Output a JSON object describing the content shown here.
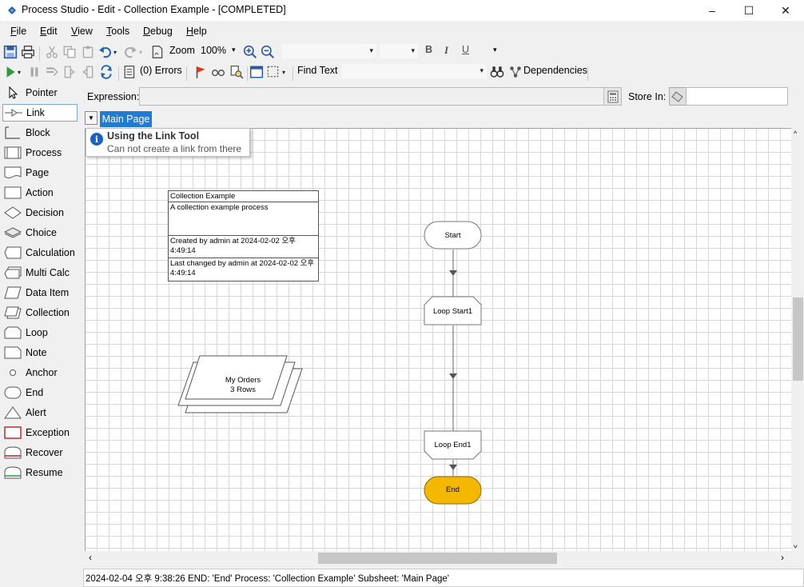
{
  "window": {
    "title": "Process Studio  - Edit - Collection Example - [COMPLETED]",
    "minimize": "–",
    "maximize": "☐",
    "close": "✕"
  },
  "menu": [
    {
      "label": "File",
      "key": "F",
      "rest": "ile"
    },
    {
      "label": "Edit",
      "key": "E",
      "rest": "dit"
    },
    {
      "label": "View",
      "key": "V",
      "rest": "iew"
    },
    {
      "label": "Tools",
      "key": "T",
      "rest": "ools"
    },
    {
      "label": "Debug",
      "key": "D",
      "rest": "ebug"
    },
    {
      "label": "Help",
      "key": "H",
      "rest": "elp"
    }
  ],
  "toolbar1": {
    "zoom_label": "Zoom",
    "zoom_value": "100%",
    "bold": "B",
    "italic": "I",
    "underline": "U"
  },
  "toolbar2": {
    "errors_label": "(0) Errors",
    "find_text": "Find Text",
    "dependencies": "Dependencies"
  },
  "toolbox": [
    {
      "name": "pointer",
      "label": "Pointer",
      "icon": "pointer-icon"
    },
    {
      "name": "link",
      "label": "Link",
      "icon": "link-icon",
      "selected": true
    },
    {
      "name": "block",
      "label": "Block",
      "icon": "block-icon"
    },
    {
      "name": "process",
      "label": "Process",
      "icon": "process-icon"
    },
    {
      "name": "page",
      "label": "Page",
      "icon": "page-icon"
    },
    {
      "name": "action",
      "label": "Action",
      "icon": "action-icon"
    },
    {
      "name": "decision",
      "label": "Decision",
      "icon": "decision-icon"
    },
    {
      "name": "choice",
      "label": "Choice",
      "icon": "choice-icon"
    },
    {
      "name": "calculation",
      "label": "Calculation",
      "icon": "calculation-icon"
    },
    {
      "name": "multi-calc",
      "label": "Multi Calc",
      "icon": "multi-calc-icon"
    },
    {
      "name": "data-item",
      "label": "Data Item",
      "icon": "data-item-icon"
    },
    {
      "name": "collection",
      "label": "Collection",
      "icon": "collection-icon"
    },
    {
      "name": "loop",
      "label": "Loop",
      "icon": "loop-icon"
    },
    {
      "name": "note",
      "label": "Note",
      "icon": "note-icon"
    },
    {
      "name": "anchor",
      "label": "Anchor",
      "icon": "anchor-icon"
    },
    {
      "name": "end",
      "label": "End",
      "icon": "end-icon"
    },
    {
      "name": "alert",
      "label": "Alert",
      "icon": "alert-icon"
    },
    {
      "name": "exception",
      "label": "Exception",
      "icon": "exception-icon"
    },
    {
      "name": "recover",
      "label": "Recover",
      "icon": "recover-icon"
    },
    {
      "name": "resume",
      "label": "Resume",
      "icon": "resume-icon"
    }
  ],
  "expression": {
    "label": "Expression:",
    "value": ""
  },
  "store_in": {
    "label": "Store In:",
    "value": ""
  },
  "tabs": [
    {
      "label": "Main Page",
      "active": true
    }
  ],
  "tooltip": {
    "title": "Using the Link Tool",
    "text": "Can not create a link from there"
  },
  "info_box": {
    "name": "Collection Example",
    "description": "A collection example process",
    "created": "Created  by  admin  at  2024-02-02 오후 4:49:14",
    "changed": "Last changed by admin at 2024-02-02 오후 4:49:14"
  },
  "stages": {
    "start": "Start",
    "loop_start": "Loop Start1",
    "loop_end": "Loop End1",
    "end": "End",
    "collection_name": "My Orders",
    "collection_rows": "3 Rows"
  },
  "colors": {
    "accent": "#1f7bd4",
    "end_fill": "#f5b800",
    "tip_icon": "#1b62c2"
  },
  "status": "2024-02-04 오후 9:38:26 END: 'End' Process: 'Collection Example' Subsheet: 'Main Page'"
}
